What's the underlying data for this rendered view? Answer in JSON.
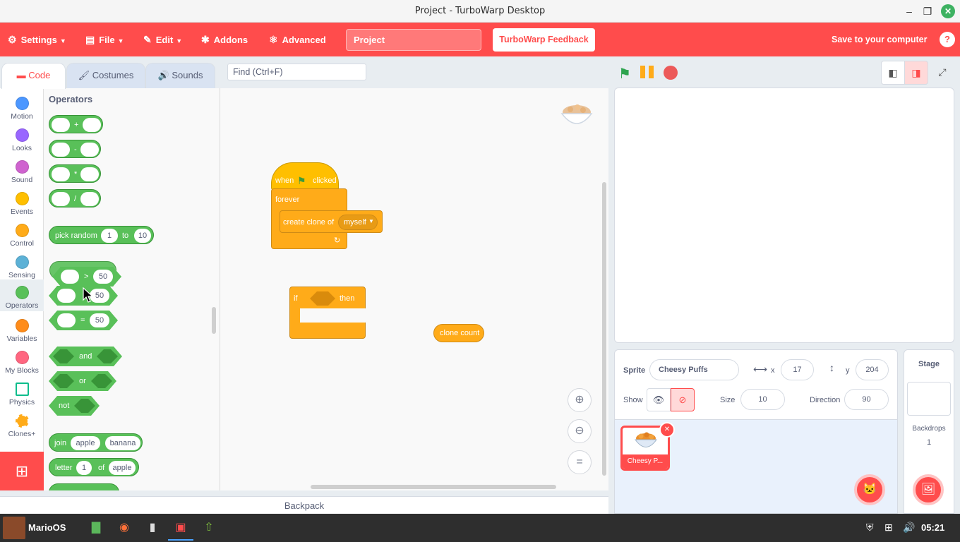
{
  "window": {
    "title": "Project - TurboWarp Desktop"
  },
  "menu": {
    "settings": "Settings",
    "file": "File",
    "edit": "Edit",
    "addons": "Addons",
    "advanced": "Advanced",
    "project_title": "Project",
    "feedback": "TurboWarp Feedback",
    "save": "Save to your computer",
    "help": "?"
  },
  "tabs": {
    "code": "Code",
    "costumes": "Costumes",
    "sounds": "Sounds"
  },
  "find": {
    "placeholder": "Find (Ctrl+F)"
  },
  "categories": [
    {
      "label": "Motion",
      "color": "#4c97ff"
    },
    {
      "label": "Looks",
      "color": "#9966ff"
    },
    {
      "label": "Sound",
      "color": "#cf63cf"
    },
    {
      "label": "Events",
      "color": "#ffbf00"
    },
    {
      "label": "Control",
      "color": "#ffab19"
    },
    {
      "label": "Sensing",
      "color": "#5cb1d6"
    },
    {
      "label": "Operators",
      "color": "#59c059"
    },
    {
      "label": "Variables",
      "color": "#ff8c1a"
    },
    {
      "label": "My Blocks",
      "color": "#ff6680"
    },
    {
      "label": "Physics",
      "color": "#0fbd8c"
    },
    {
      "label": "Clones+",
      "color": "#ffab19"
    }
  ],
  "flyout": {
    "heading": "Operators",
    "add_op": "+",
    "sub_op": "-",
    "mul_op": "*",
    "div_op": "/",
    "pick_random": "pick random",
    "rand_from": "1",
    "to": "to",
    "rand_to": "10",
    "gt_op": ">",
    "gt_val": "50",
    "lt_val": "50",
    "eq_op": "=",
    "eq_val": "50",
    "and": "and",
    "or": "or",
    "not": "not",
    "join": "join",
    "join_a": "apple",
    "join_b": "banana",
    "letter": "letter",
    "letter_n": "1",
    "of": "of",
    "letter_of": "apple"
  },
  "workspace": {
    "hat_when": "when",
    "hat_clicked": "clicked",
    "forever": "forever",
    "create_clone": "create clone of",
    "clone_target": "myself",
    "if": "if",
    "then": "then",
    "clone_count": "clone count"
  },
  "backpack": "Backpack",
  "sprite": {
    "label_sprite": "Sprite",
    "name": "Cheesy Puffs",
    "label_x": "x",
    "x": "17",
    "label_y": "y",
    "y": "204",
    "label_show": "Show",
    "label_size": "Size",
    "size": "10",
    "label_direction": "Direction",
    "direction": "90",
    "thumb_name": "Cheesy P..."
  },
  "stage_pane": {
    "title": "Stage",
    "backdrops_label": "Backdrops",
    "backdrops_count": "1"
  },
  "taskbar": {
    "start_label": "MarioOS",
    "time": "05:21"
  }
}
